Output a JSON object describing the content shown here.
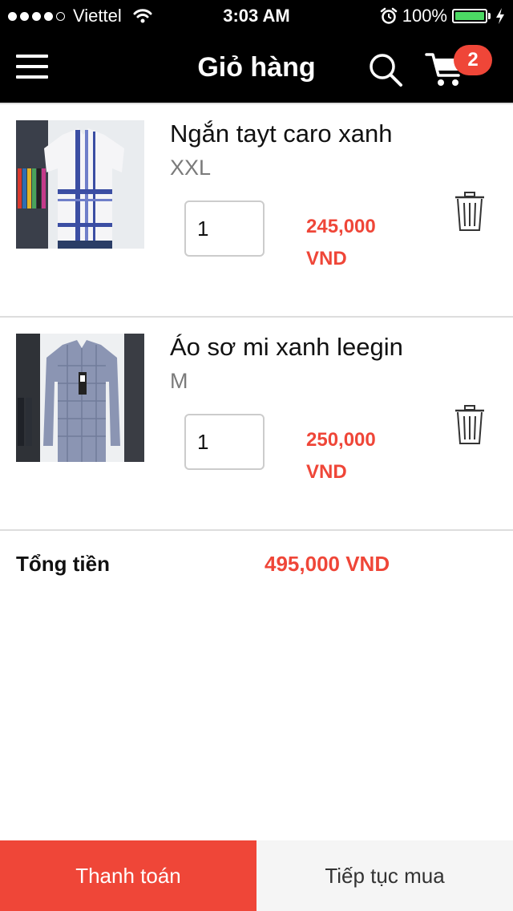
{
  "status_bar": {
    "carrier": "Viettel",
    "time": "3:03 AM",
    "battery": "100%",
    "signal_bars_filled": 4,
    "signal_bars_total": 5,
    "battery_level": 1.0
  },
  "nav": {
    "title": "Giỏ hàng",
    "cart_count": "2",
    "icons": {
      "menu": "hamburger-menu-icon",
      "search": "search-icon",
      "cart": "shopping-cart-icon"
    }
  },
  "items": [
    {
      "name": "Ngắn tayt caro xanh",
      "size": "XXL",
      "quantity": "1",
      "price": "245,000",
      "currency": "VND"
    },
    {
      "name": "Áo sơ mi xanh leegin",
      "size": "M",
      "quantity": "1",
      "price": "250,000",
      "currency": "VND"
    }
  ],
  "total": {
    "label": "Tổng tiền",
    "value": "495,000 VND"
  },
  "buttons": {
    "checkout": "Thanh toán",
    "continue": "Tiếp tục mua"
  },
  "colors": {
    "accent": "#ef4638",
    "header_bg": "#000000",
    "battery": "#4cd964",
    "secondary_button_bg": "#f5f5f5"
  }
}
